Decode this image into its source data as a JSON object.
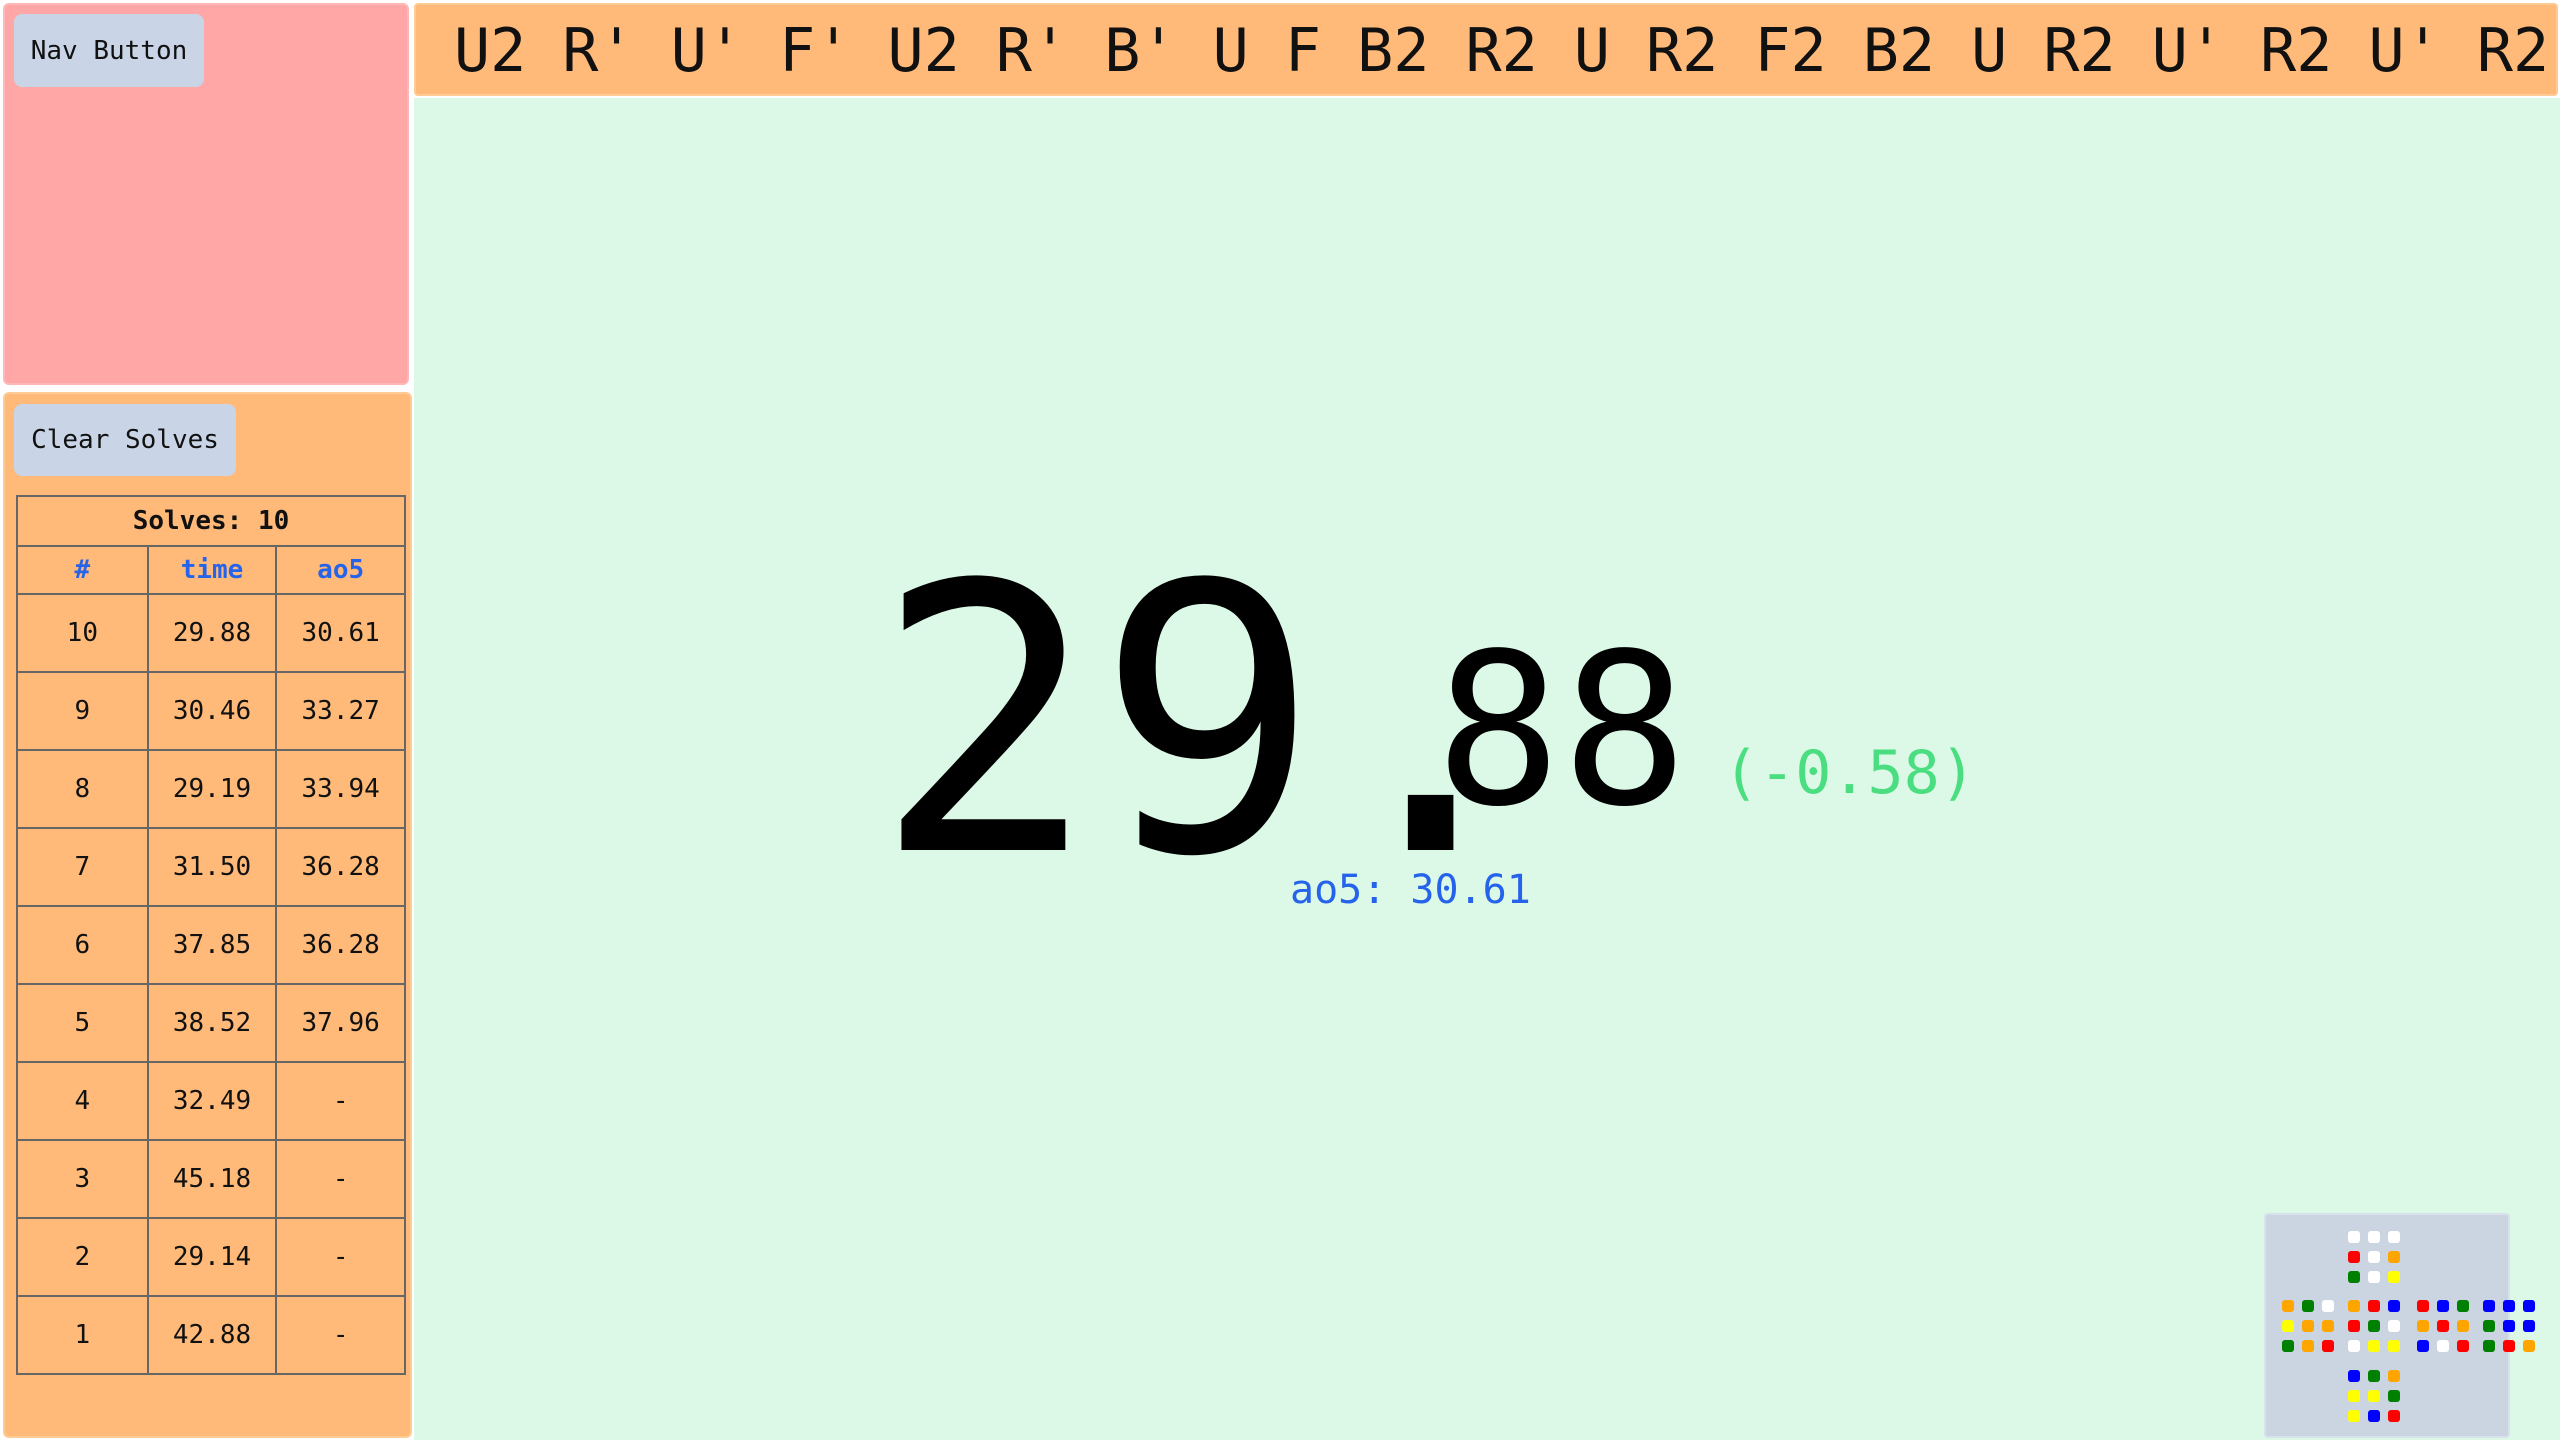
{
  "nav": {
    "button_label": "Nav Button"
  },
  "sidebar": {
    "clear_label": "Clear Solves",
    "table": {
      "title": "Solves: 10",
      "columns": [
        "#",
        "time",
        "ao5"
      ],
      "rows": [
        [
          "10",
          "29.88",
          "30.61"
        ],
        [
          "9",
          "30.46",
          "33.27"
        ],
        [
          "8",
          "29.19",
          "33.94"
        ],
        [
          "7",
          "31.50",
          "36.28"
        ],
        [
          "6",
          "37.85",
          "36.28"
        ],
        [
          "5",
          "38.52",
          "37.96"
        ],
        [
          "4",
          "32.49",
          "-"
        ],
        [
          "3",
          "45.18",
          "-"
        ],
        [
          "2",
          "29.14",
          "-"
        ],
        [
          "1",
          "42.88",
          "-"
        ]
      ]
    }
  },
  "scramble": "U2 R' U' F' U2 R' B' U F B2 R2 U R2 F2 B2 U R2 U' R2 U' R2",
  "timer": {
    "whole": "29.",
    "fraction": "88",
    "diff": "(-0.58)",
    "ao5_label": "ao5: 30.61"
  },
  "colors": {
    "white": "#ffffff",
    "yellow": "#ffff00",
    "red": "#ff0000",
    "orange": "#ffa500",
    "green": "#008000",
    "blue": "#0000ff",
    "ao5_text": "#2563eb",
    "diff_text": "#4ade80"
  },
  "cube": {
    "U": [
      "white",
      "white",
      "white",
      "red",
      "white",
      "orange",
      "green",
      "white",
      "yellow"
    ],
    "L": [
      "orange",
      "green",
      "white",
      "yellow",
      "orange",
      "orange",
      "green",
      "orange",
      "red"
    ],
    "F": [
      "orange",
      "red",
      "blue",
      "red",
      "green",
      "white",
      "white",
      "yellow",
      "yellow"
    ],
    "R": [
      "red",
      "blue",
      "green",
      "orange",
      "red",
      "orange",
      "blue",
      "white",
      "red"
    ],
    "B": [
      "blue",
      "blue",
      "blue",
      "green",
      "blue",
      "blue",
      "green",
      "red",
      "orange"
    ],
    "D": [
      "blue",
      "green",
      "orange",
      "yellow",
      "yellow",
      "green",
      "yellow",
      "blue",
      "red"
    ]
  }
}
